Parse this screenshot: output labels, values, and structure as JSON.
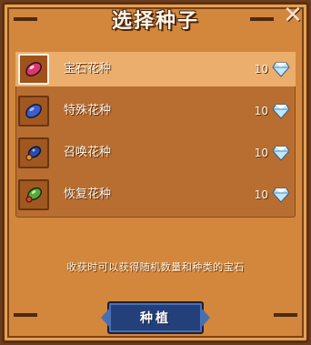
{
  "dialog": {
    "title": "选择种子",
    "close_label": "✕"
  },
  "seeds": [
    {
      "name": "宝石花种",
      "count": "10",
      "seed_color": "#d83a6e",
      "selected": true
    },
    {
      "name": "特殊花种",
      "count": "10",
      "seed_color": "#3d5dc8",
      "selected": false
    },
    {
      "name": "召唤花种",
      "count": "10",
      "seed_color": "#2b4aa8",
      "selected": false
    },
    {
      "name": "恢复花种",
      "count": "10",
      "seed_color": "#5aa83a",
      "selected": false
    }
  ],
  "hint": "收获时可以获得随机数量和种类的宝石",
  "actions": {
    "plant_label": "种植"
  },
  "colors": {
    "panel": "#d2873d",
    "selected_row": "#ebae6c",
    "button": "#23407a"
  }
}
